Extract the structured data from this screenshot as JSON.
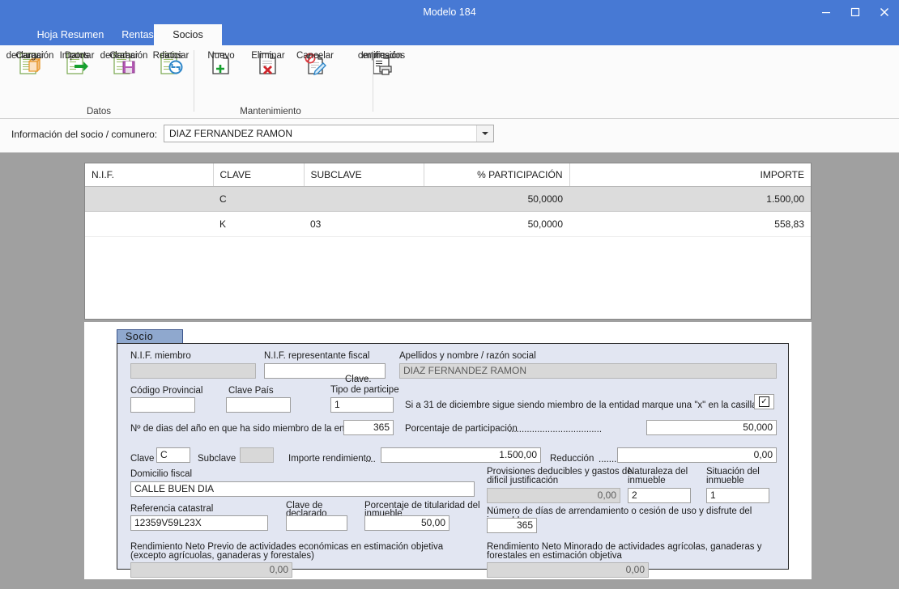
{
  "window": {
    "title": "Modelo 184",
    "minimize_icon": "minimize-icon",
    "maximize_icon": "maximize-icon",
    "close_icon": "close-icon",
    "titlebar_color": "#4779d4"
  },
  "tabs": [
    {
      "label": "Hoja Resumen",
      "active": false
    },
    {
      "label": "Rentas",
      "active": false
    },
    {
      "label": "Socios",
      "active": true
    }
  ],
  "ribbon": {
    "groups": [
      {
        "name": "Datos",
        "buttons": [
          {
            "label_line1": "Cargar",
            "label_line2": "declaración",
            "icon": "load-declaration-icon"
          },
          {
            "label_line1": "Importar",
            "label_line2": "Datos",
            "icon": "import-data-icon"
          },
          {
            "label_line1": "Grabar",
            "label_line2": "declaración",
            "icon": "save-declaration-icon"
          },
          {
            "label_line1": "Reiniciar",
            "label_line2": "datos",
            "icon": "reset-data-icon"
          }
        ]
      },
      {
        "name": "Mantenimiento",
        "buttons": [
          {
            "label_line1": "Nuevo",
            "label_line2": "",
            "icon": "new-record-icon"
          },
          {
            "label_line1": "Eliminar",
            "label_line2": "",
            "icon": "delete-record-icon"
          },
          {
            "label_line1": "Cancelar",
            "label_line2": "",
            "icon": "cancel-edit-icon"
          },
          {
            "label_line1": "Impresión",
            "label_line2": "certificados",
            "icon": "print-certificates-icon"
          }
        ]
      }
    ]
  },
  "selector": {
    "label": "Información del socio / comunero:",
    "value": "DIAZ FERNANDEZ RAMON",
    "dropdown_icon": "chevron-down-icon"
  },
  "grid": {
    "columns": [
      {
        "label": "N.I.F.",
        "align": "left"
      },
      {
        "label": "CLAVE",
        "align": "left"
      },
      {
        "label": "SUBCLAVE",
        "align": "left"
      },
      {
        "label": "% PARTICIPACIÓN",
        "align": "right"
      },
      {
        "label": "IMPORTE",
        "align": "right"
      }
    ],
    "rows": [
      {
        "nif": "",
        "clave": "C",
        "subclave": "",
        "participacion": "50,0000",
        "importe": "1.500,00",
        "selected": true
      },
      {
        "nif": "",
        "clave": "K",
        "subclave": "03",
        "participacion": "50,0000",
        "importe": "558,83",
        "selected": false
      }
    ]
  },
  "form": {
    "tab_label": "Socio",
    "nif_miembro_label": "N.I.F. miembro",
    "nif_miembro_value": "",
    "nif_representante_label": "N.I.F. representante fiscal",
    "nif_representante_value": "",
    "apellidos_label": "Apellidos y nombre / razón social",
    "apellidos_value": "DIAZ FERNANDEZ RAMON",
    "codigo_provincial_label": "Código Provincial",
    "codigo_provincial_value": "",
    "clave_pais_label": "Clave País",
    "clave_pais_value": "",
    "clave_tipo_label_line1": "Clave.",
    "clave_tipo_label_line2": "Tipo de participe",
    "clave_tipo_value": "1",
    "casilla_text": "Si a 31 de diciembre sigue siendo miembro de la entidad marque una \"x\" en la casilla",
    "casilla_checked": true,
    "casilla_mark": "✓",
    "dias_label": "Nº de dias del año en que ha sido miembro de la entidad",
    "dias_value": "365",
    "porcentaje_participacion_label": "Porcentaje de participación",
    "porcentaje_participacion_dots": "....................................",
    "porcentaje_participacion_value": "50,000",
    "clave_label": "Clave",
    "clave_value": "C",
    "subclave_label": "Subclave",
    "subclave_value": "",
    "importe_rendimiento_label": "Importe rendimiento",
    "importe_rendimiento_dots": "....",
    "importe_rendimiento_value": "1.500,00",
    "reduccion_label": "Reducción",
    "reduccion_dots": ".......",
    "reduccion_value": "0,00",
    "domicilio_label": "Domicilio fiscal",
    "domicilio_value": "CALLE BUEN DIA",
    "provisiones_label_line1": "Provisiones deducibles y gastos de",
    "provisiones_label_line2": "dificil justificación",
    "provisiones_value": "0,00",
    "naturaleza_label_line1": "Naturaleza del",
    "naturaleza_label_line2": "inmueble",
    "naturaleza_value": "2",
    "situacion_label_line1": "Situación del",
    "situacion_label_line2": "inmueble",
    "situacion_value": "1",
    "referencia_label": "Referencia catastral",
    "referencia_value": "12359V59L23X",
    "clave_declarado_label_line1": "Clave de",
    "clave_declarado_label_line2": "declarado",
    "clave_declarado_value": "",
    "porcentaje_titularidad_label_line1": "Porcentaje de titularidad del",
    "porcentaje_titularidad_label_line2": "inmueble",
    "porcentaje_titularidad_value": "50,00",
    "dias_arrendamiento_label": "Número de días de arrendamiento o cesión de uso y disfrute del inmueble",
    "dias_arrendamiento_value": "365",
    "rn_previo_label_line1": "Rendimiento Neto Previo de actividades económicas en estimación objetiva",
    "rn_previo_label_line2": "(excepto agrícuolas, ganaderas y forestales)",
    "rn_previo_value": "0,00",
    "rn_minorado_label_line1": "Rendimiento Neto Minorado de actividades agrícolas, ganaderas y",
    "rn_minorado_label_line2": "forestales en estimación objetiva",
    "rn_minorado_value": "0,00"
  }
}
